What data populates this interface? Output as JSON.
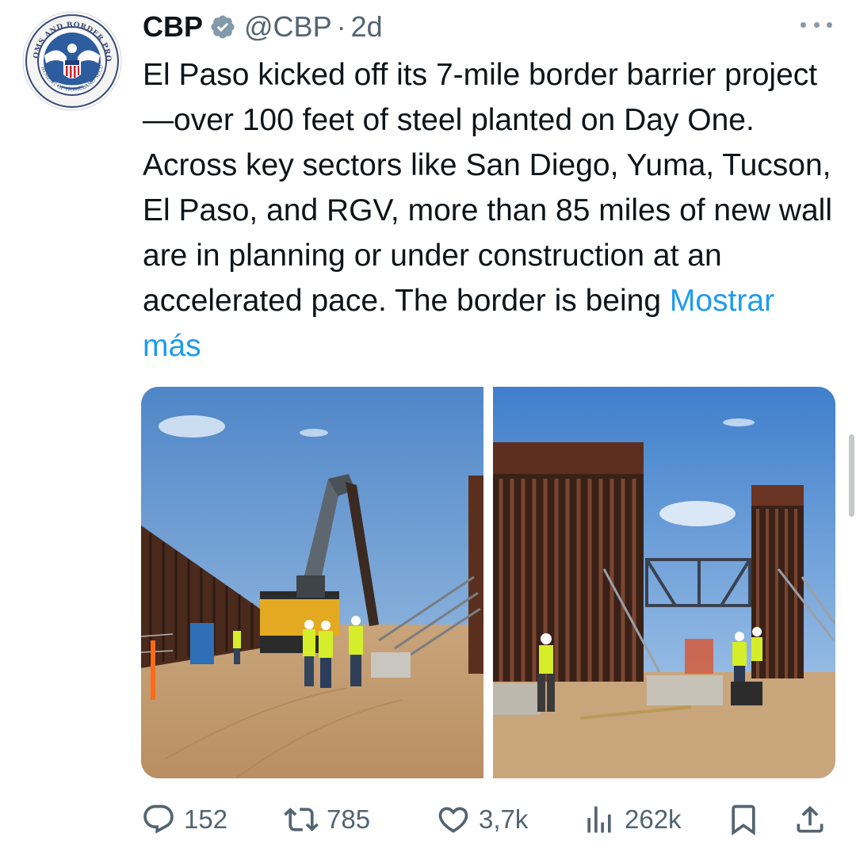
{
  "tweet": {
    "author_name": "CBP",
    "handle": "@CBP",
    "separator": "·",
    "time": "2d",
    "text": "El Paso kicked off its 7-mile border barrier project—over 100 feet of steel planted on Day One. Across key sectors like San Diego, Yuma, Tucson, El Paso, and RGV, more than 85 miles of new wall are in planning or under construction at an accelerated pace. The border is being ",
    "show_more": "Mostrar más"
  },
  "avatar": {
    "logo_text": "U.S. CUSTOMS AND BORDER PROTECTION · DEPARTMENT OF HOMELAND SECURITY"
  },
  "actions": {
    "replies": "152",
    "reposts": "785",
    "likes": "3,7k",
    "views": "262k"
  },
  "icons": {
    "verified": "verified-badge-icon",
    "more": "more-icon",
    "reply": "reply-icon",
    "repost": "repost-icon",
    "like": "like-icon",
    "views": "views-icon",
    "bookmark": "bookmark-icon",
    "share": "share-icon"
  },
  "colors": {
    "text": "#0f1419",
    "secondary": "#536471",
    "link": "#1d9bf0",
    "verified": "#829aab"
  }
}
